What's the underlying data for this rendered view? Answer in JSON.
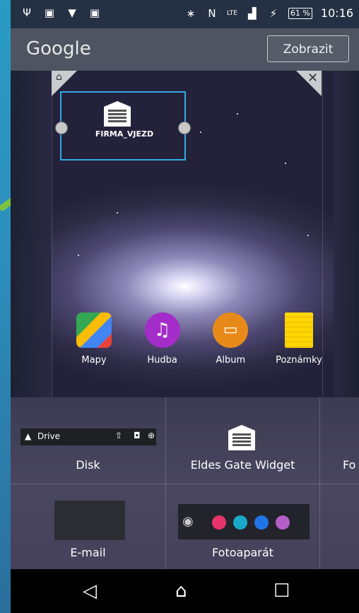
{
  "status_bar": {
    "battery_percent": "61 %",
    "time": "10:16",
    "network": "LTE"
  },
  "search_bar": {
    "logo_text": "Google",
    "button_label": "Zobrazit"
  },
  "widget": {
    "label": "FIRMA_VJEZD"
  },
  "home_apps": [
    {
      "label": "Mapy"
    },
    {
      "label": "Hudba"
    },
    {
      "label": "Album"
    },
    {
      "label": "Poznámky"
    }
  ],
  "drawer": {
    "drive_title": "Drive",
    "items": [
      {
        "label": "Disk"
      },
      {
        "label": "Eldes Gate Widget"
      },
      {
        "label": "Fo"
      },
      {
        "label": "E-mail"
      },
      {
        "label": "Fotoaparát"
      }
    ]
  },
  "colors": {
    "selection_border": "#34a9e4",
    "arrow": "#7cc242",
    "status_bar_bg": "#243043"
  }
}
